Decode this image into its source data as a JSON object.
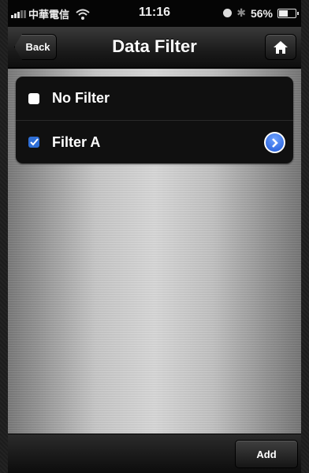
{
  "status_bar": {
    "carrier": "中華電信",
    "time": "11:16",
    "battery": "56%",
    "battery_level": 0.56
  },
  "navbar": {
    "back_label": "Back",
    "title": "Data Filter",
    "home_icon": "home-icon"
  },
  "filters": [
    {
      "label": "No Filter",
      "checked": false
    },
    {
      "label": "Filter A",
      "checked": true,
      "has_detail": true
    }
  ],
  "toolbar": {
    "add_label": "Add"
  },
  "colors": {
    "accent": "#2f6fd6",
    "nav_bg": "#1b1b1b"
  }
}
